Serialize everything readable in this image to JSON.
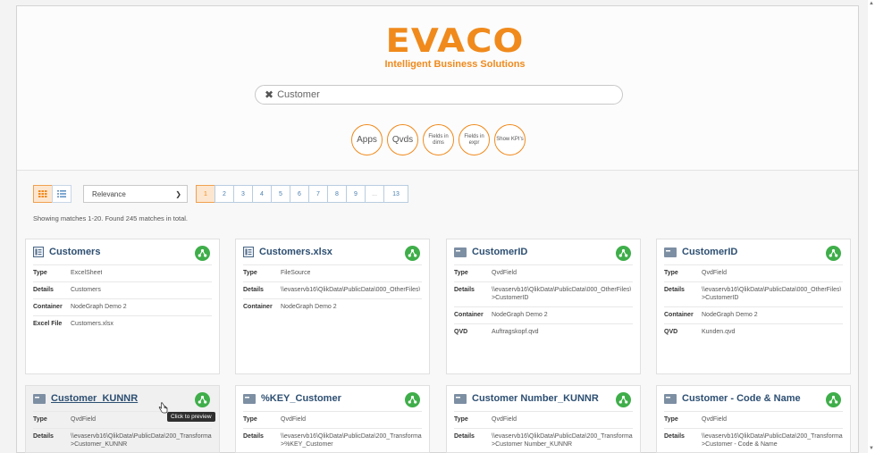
{
  "brand": {
    "name": "EVACO",
    "tagline": "Intelligent Business Solutions",
    "color": "#f08a1c"
  },
  "search": {
    "value": "Customer",
    "clear_icon": "close-icon"
  },
  "filters": [
    {
      "label": "Apps"
    },
    {
      "label": "Qvds"
    },
    {
      "label": "Fields in dims"
    },
    {
      "label": "Fields in expr"
    },
    {
      "label": "Show KPI's"
    }
  ],
  "toolbar": {
    "sort_selected": "Relevance",
    "pages": [
      "1",
      "2",
      "3",
      "4",
      "5",
      "6",
      "7",
      "8",
      "9",
      "...",
      "13"
    ],
    "active_page": "1"
  },
  "results_text": "Showing matches 1-20. Found 245 matches in total.",
  "cards": [
    {
      "title": "Customers",
      "icon": "excel-sheet-icon",
      "rows": [
        {
          "k": "Type",
          "v": "ExcelSheet"
        },
        {
          "k": "Details",
          "v": "Customers"
        },
        {
          "k": "Container",
          "v": "NodeGraph Demo 2"
        },
        {
          "k": "Excel File",
          "v": "Customers.xlsx"
        }
      ]
    },
    {
      "title": "Customers.xlsx",
      "icon": "file-source-icon",
      "rows": [
        {
          "k": "Type",
          "v": "FileSource"
        },
        {
          "k": "Details",
          "v": "\\\\evaservb16\\QlikData\\PublicData\\000_OtherFiles\\"
        },
        {
          "k": "Container",
          "v": "NodeGraph Demo 2"
        }
      ]
    },
    {
      "title": "CustomerID",
      "icon": "qvd-field-icon",
      "rows": [
        {
          "k": "Type",
          "v": "QvdField"
        },
        {
          "k": "Details",
          "v": "\\\\evaservb16\\QlikData\\PublicData\\000_OtherFiles\\",
          "v2": ">CustomerID"
        },
        {
          "k": "Container",
          "v": "NodeGraph Demo 2"
        },
        {
          "k": "QVD",
          "v": "Auftragskopf.qvd"
        }
      ]
    },
    {
      "title": "CustomerID",
      "icon": "qvd-field-icon",
      "rows": [
        {
          "k": "Type",
          "v": "QvdField"
        },
        {
          "k": "Details",
          "v": "\\\\evaservb16\\QlikData\\PublicData\\000_OtherFiles\\",
          "v2": ">CustomerID"
        },
        {
          "k": "Container",
          "v": "NodeGraph Demo 2"
        },
        {
          "k": "QVD",
          "v": "Kunden.qvd"
        }
      ]
    },
    {
      "title": "Customer_KUNNR",
      "icon": "qvd-field-icon",
      "rows": [
        {
          "k": "Type",
          "v": "QvdField"
        },
        {
          "k": "Details",
          "v": "\\\\evaservb16\\QlikData\\PublicData\\200_Transforma",
          "v2": ">Customer_KUNNR"
        }
      ]
    },
    {
      "title": "%KEY_Customer",
      "icon": "qvd-field-icon",
      "rows": [
        {
          "k": "Type",
          "v": "QvdField"
        },
        {
          "k": "Details",
          "v": "\\\\evaservb16\\QlikData\\PublicData\\200_Transforma",
          "v2": ">%KEY_Customer"
        }
      ]
    },
    {
      "title": "Customer Number_KUNNR",
      "icon": "qvd-field-icon",
      "rows": [
        {
          "k": "Type",
          "v": "QvdField"
        },
        {
          "k": "Details",
          "v": "\\\\evaservb16\\QlikData\\PublicData\\200_Transforma",
          "v2": ">Customer Number_KUNNR"
        }
      ]
    },
    {
      "title": "Customer - Code & Name",
      "icon": "qvd-field-icon",
      "rows": [
        {
          "k": "Type",
          "v": "QvdField"
        },
        {
          "k": "Details",
          "v": "\\\\evaservb16\\QlikData\\PublicData\\200_Transforma",
          "v2": ">Customer - Code & Name"
        }
      ]
    }
  ],
  "tooltip": "Click to preview"
}
